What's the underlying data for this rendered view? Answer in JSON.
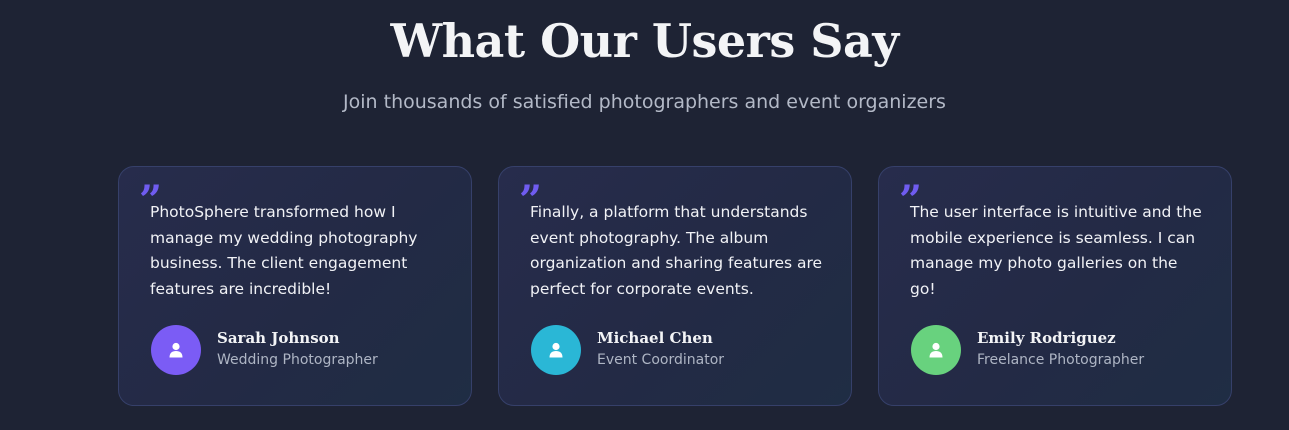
{
  "section": {
    "title": "What Our Users Say",
    "subtitle": "Join thousands of satisfied photographers and event organizers"
  },
  "testimonials": [
    {
      "quote_mark": "”",
      "text": "PhotoSphere transformed how I manage my wedding photography business. The client engagement features are incredible!",
      "name": "Sarah Johnson",
      "role": "Wedding Photographer",
      "avatar_icon": "user-icon",
      "avatar_color": "#7b5cf5"
    },
    {
      "quote_mark": "”",
      "text": "Finally, a platform that understands event photography. The album organization and sharing features are perfect for corporate events.",
      "name": "Michael Chen",
      "role": "Event Coordinator",
      "avatar_icon": "user-icon",
      "avatar_color": "#2ab7d6"
    },
    {
      "quote_mark": "”",
      "text": "The user interface is intuitive and the mobile experience is seamless. I can manage my photo galleries on the go!",
      "name": "Emily Rodriguez",
      "role": "Freelance Photographer",
      "avatar_icon": "user-icon",
      "avatar_color": "#68d27e"
    }
  ],
  "colors": {
    "background": "#1e2334",
    "accent_quote": "#6f5cf0",
    "card_border": "#36406a"
  }
}
